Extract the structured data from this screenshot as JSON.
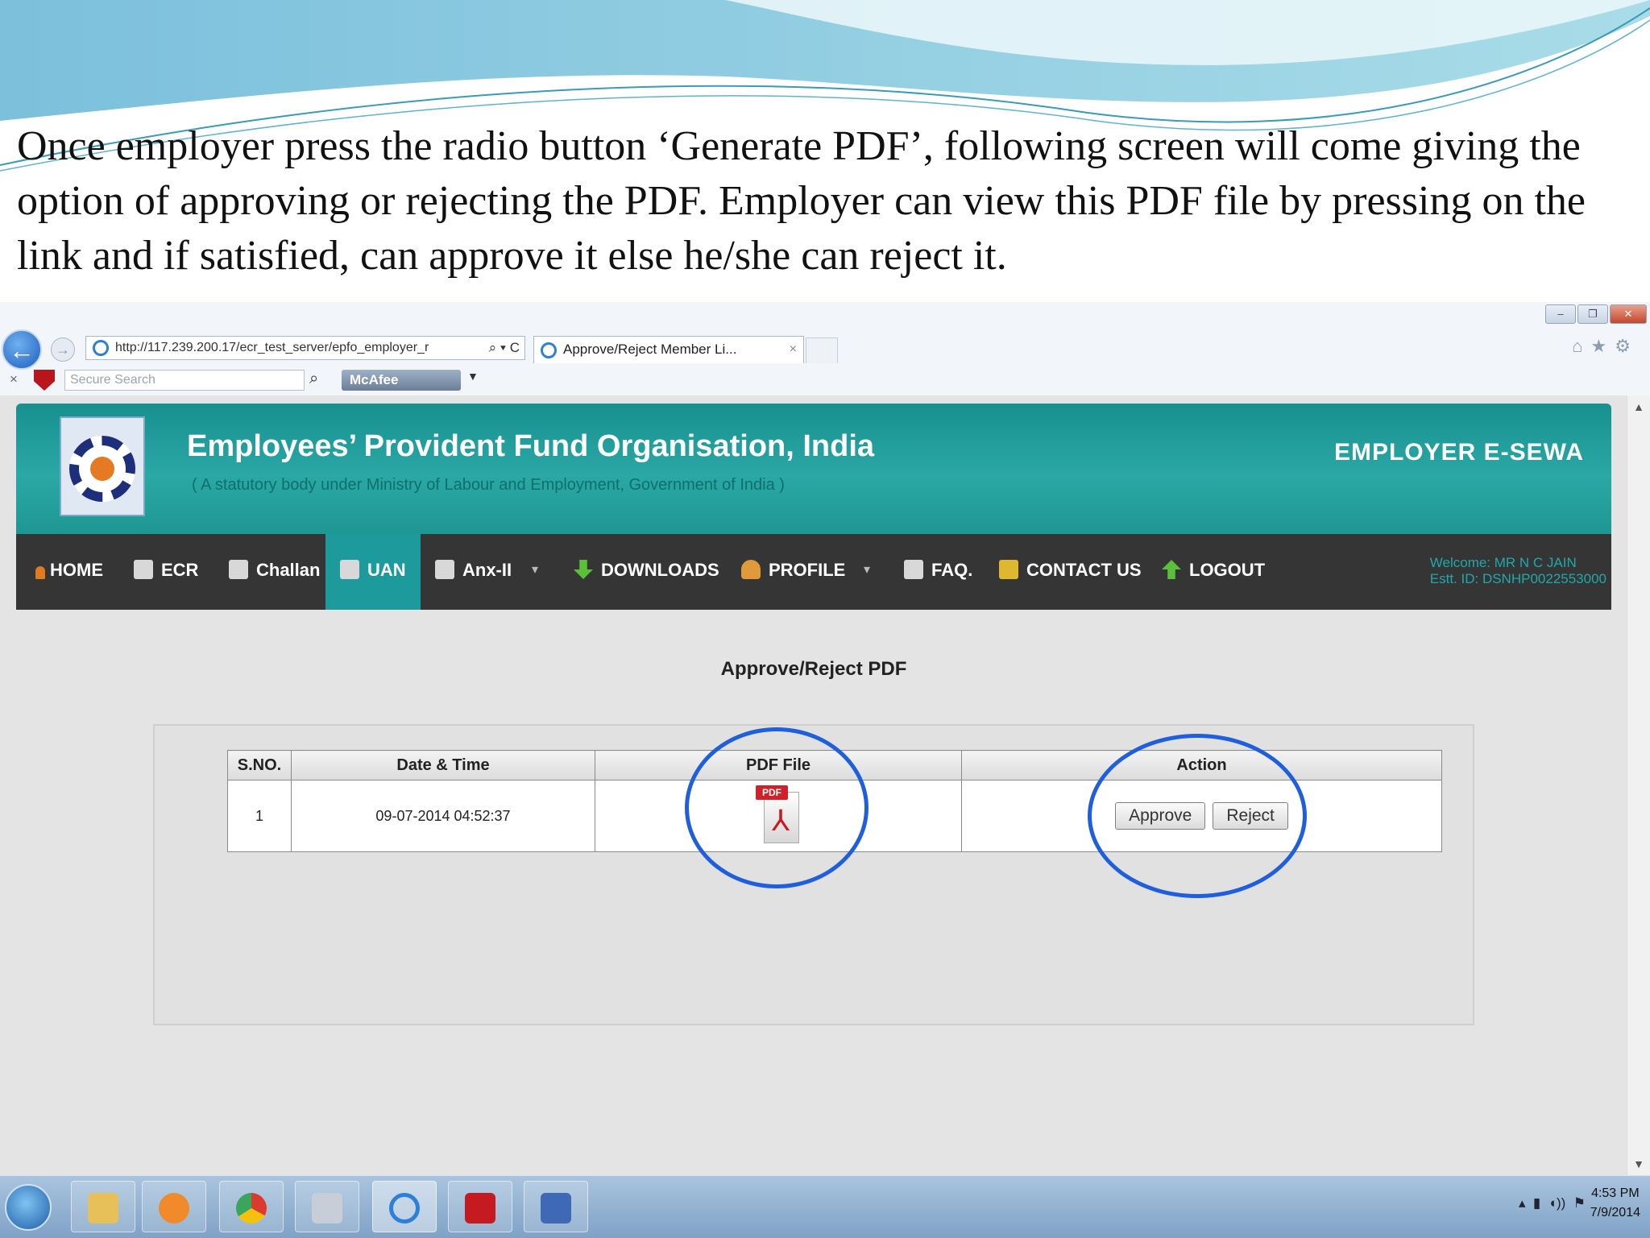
{
  "slide": {
    "caption": "Once employer press the radio button ‘Generate PDF’, following screen will come giving the option of approving or rejecting the PDF. Employer can view this PDF file by pressing on the link and if satisfied, can approve it else he/she can reject it."
  },
  "browser": {
    "address": "http://117.239.200.17/ecr_test_server/epfo_employer_r",
    "address_tools": "⌕ ▾ C",
    "tab_title": "Approve/Reject Member Li...",
    "tab_close": "×",
    "search_placeholder": "Secure Search",
    "mcafee_label": "McAfee",
    "window_controls": [
      "–",
      "❐",
      "✕"
    ],
    "right_icons": "⌂★⚙"
  },
  "site": {
    "org_title": "Employees’ Provident Fund Organisation, India",
    "org_subtitle": "( A statutory body under Ministry of Labour and Employment, Government of India )",
    "portal_name": "EMPLOYER E-SEWA",
    "menu": [
      {
        "label": "HOME",
        "icon": "home-icon"
      },
      {
        "label": "ECR",
        "icon": "document-icon"
      },
      {
        "label": "Challan",
        "icon": "printer-icon"
      },
      {
        "label": "UAN",
        "icon": "document-icon",
        "active": true
      },
      {
        "label": "Anx-II",
        "icon": "document-icon",
        "has_dropdown": true
      },
      {
        "label": "DOWNLOADS",
        "icon": "download-arrow-icon"
      },
      {
        "label": "PROFILE",
        "icon": "profile-icon",
        "has_dropdown": true
      },
      {
        "label": "FAQ.",
        "icon": "edit-icon"
      },
      {
        "label": "CONTACT US",
        "icon": "contact-card-icon"
      },
      {
        "label": "LOGOUT",
        "icon": "upload-arrow-icon"
      }
    ],
    "welcome_line": "Welcome: MR N C JAIN",
    "estt_line": "Estt. ID: DSNHP0022553000"
  },
  "content": {
    "title": "Approve/Reject PDF",
    "table": {
      "headers": [
        "S.NO.",
        "Date & Time",
        "PDF File",
        "Action"
      ],
      "rows": [
        {
          "sno": "1",
          "datetime": "09-07-2014 04:52:37",
          "pdf_tag": "PDF",
          "approve": "Approve",
          "reject": "Reject"
        }
      ]
    }
  },
  "taskbar": {
    "clock_time": "4:53 PM",
    "clock_date": "7/9/2014"
  },
  "colors": {
    "header_teal": "#1d9a9b",
    "menu_dark": "#353535",
    "highlight_blue": "#1f5fdc"
  }
}
